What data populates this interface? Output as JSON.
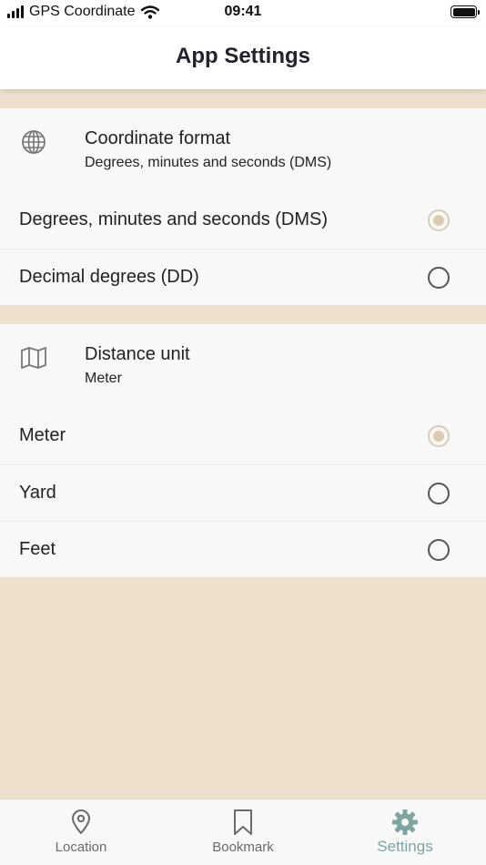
{
  "status_bar": {
    "carrier": "GPS Coordinate",
    "time": "09:41"
  },
  "header": {
    "title": "App Settings"
  },
  "coordinate_section": {
    "icon": "globe-icon",
    "title": "Coordinate format",
    "current_value": "Degrees, minutes and seconds (DMS)",
    "options": [
      {
        "label": "Degrees, minutes and seconds (DMS)",
        "selected": true
      },
      {
        "label": "Decimal degrees (DD)",
        "selected": false
      }
    ]
  },
  "distance_section": {
    "icon": "map-icon",
    "title": "Distance unit",
    "current_value": "Meter",
    "options": [
      {
        "label": "Meter",
        "selected": true
      },
      {
        "label": "Yard",
        "selected": false
      },
      {
        "label": "Feet",
        "selected": false
      }
    ]
  },
  "tab_bar": {
    "tabs": [
      {
        "label": "Location",
        "icon": "map-pin-icon",
        "active": false
      },
      {
        "label": "Bookmark",
        "icon": "bookmark-icon",
        "active": false
      },
      {
        "label": "Settings",
        "icon": "gear-icon",
        "active": true
      }
    ]
  },
  "colors": {
    "background": "#ede1cd",
    "selected_radio": "#dccbb0",
    "active_tab": "#7ea5a0"
  }
}
